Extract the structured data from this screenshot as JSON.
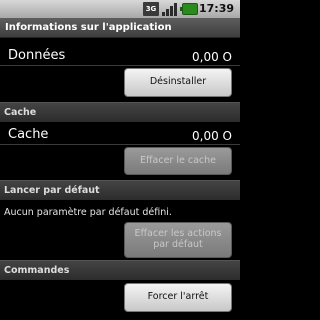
{
  "status_bar": {
    "network_label": "3G",
    "time": "17:39"
  },
  "title_bar": {
    "title": "Informations sur l'application"
  },
  "storage": {
    "data_label": "Données",
    "data_value": "0,00 O",
    "uninstall_label": "Désinstaller"
  },
  "cache": {
    "header": "Cache",
    "cache_label": "Cache",
    "cache_value": "0,00 O",
    "clear_cache_label": "Effacer le cache"
  },
  "launch_default": {
    "header": "Lancer par défaut",
    "hint": "Aucun paramètre par défaut défini.",
    "clear_defaults_line1": "Effacer les actions",
    "clear_defaults_line2": "par défaut"
  },
  "controls": {
    "header": "Commandes",
    "force_stop_label": "Forcer l'arrêt"
  }
}
